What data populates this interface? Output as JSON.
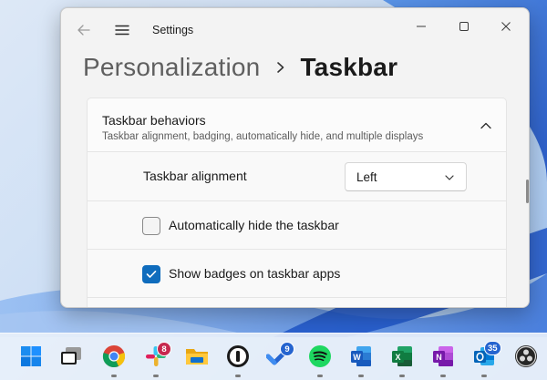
{
  "window": {
    "app_title": "Settings",
    "breadcrumb": {
      "parent": "Personalization",
      "current": "Taskbar"
    }
  },
  "taskbar_behaviors": {
    "title": "Taskbar behaviors",
    "subtitle": "Taskbar alignment, badging, automatically hide, and multiple displays",
    "expanded": true,
    "alignment": {
      "label": "Taskbar alignment",
      "value": "Left"
    },
    "auto_hide": {
      "label": "Automatically hide the taskbar",
      "checked": false
    },
    "show_badges": {
      "label": "Show badges on taskbar apps",
      "checked": true
    }
  },
  "taskbar": {
    "apps": [
      {
        "name": "start",
        "icon": "windows-logo-icon",
        "running": false
      },
      {
        "name": "task-view",
        "icon": "task-view-icon",
        "running": false
      },
      {
        "name": "chrome",
        "icon": "chrome-icon",
        "running": true
      },
      {
        "name": "slack",
        "icon": "slack-icon",
        "running": true,
        "badge": "8"
      },
      {
        "name": "file-explorer",
        "icon": "folder-icon",
        "running": false
      },
      {
        "name": "1password",
        "icon": "1password-icon",
        "running": true
      },
      {
        "name": "todo",
        "icon": "todo-check-icon",
        "running": false,
        "badge": "9"
      },
      {
        "name": "spotify",
        "icon": "spotify-icon",
        "running": true
      },
      {
        "name": "word",
        "icon": "word-icon",
        "running": true
      },
      {
        "name": "excel",
        "icon": "excel-icon",
        "running": true
      },
      {
        "name": "onenote",
        "icon": "onenote-icon",
        "running": true
      },
      {
        "name": "outlook",
        "icon": "outlook-icon",
        "running": true,
        "badge": "35"
      },
      {
        "name": "obs",
        "icon": "obs-icon",
        "running": false
      }
    ]
  },
  "colors": {
    "accent": "#0f6cbd",
    "slack_badge": "#c6284e",
    "todo_badge": "#2564cf",
    "outlook_badge": "#2564cf"
  }
}
